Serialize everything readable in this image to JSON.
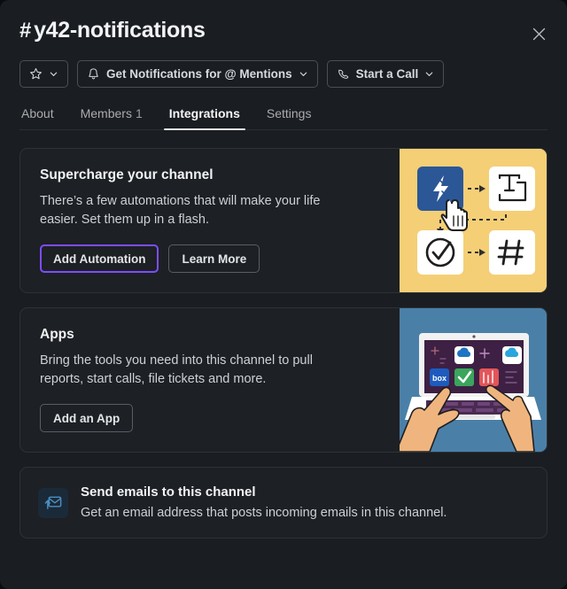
{
  "header": {
    "hash": "#",
    "channel_name": "y42-notifications",
    "close_label": "close-dialog"
  },
  "toolbar": {
    "buttons": [
      {
        "icon": "star-icon",
        "label": "",
        "has_chevron": true,
        "name": "star-channel-button"
      },
      {
        "icon": "bell-icon",
        "label": "Get Notifications for @ Mentions",
        "has_chevron": true,
        "name": "notifications-button"
      },
      {
        "icon": "phone-icon",
        "label": "Start a Call",
        "has_chevron": true,
        "name": "start-call-button"
      }
    ]
  },
  "tabs": [
    {
      "label": "About",
      "count": "",
      "active": false
    },
    {
      "label": "Members",
      "count": "1",
      "active": false
    },
    {
      "label": "Integrations",
      "count": "",
      "active": true
    },
    {
      "label": "Settings",
      "count": "",
      "active": false
    }
  ],
  "cards": [
    {
      "title": "Supercharge your channel",
      "description": "There’s a few automations that will make your life easier. Set them up in a flash.",
      "primary_button": "Add Automation",
      "secondary_button": "Learn More",
      "illustration": "automation-workflow-illustration",
      "illustration_bg": "#f5cf76"
    },
    {
      "title": "Apps",
      "description": "Bring the tools you need into this channel to pull reports, start calls, file tickets and more.",
      "primary_button": "Add an App",
      "illustration": "laptop-hands-apps-illustration",
      "illustration_bg": "#4a80a8"
    }
  ],
  "email_row": {
    "icon": "email-arrow-icon",
    "title": "Send emails to this channel",
    "description": "Get an email address that posts incoming emails in this channel."
  },
  "colors": {
    "modal_bg": "#1a1d21",
    "card_bg": "#1d2024",
    "focus_purple": "#7c4dff",
    "illustration_yellow": "#f5cf76",
    "illustration_blue": "#4a80a8",
    "tile_blue": "#2b5797",
    "laptop_screen": "#3d2043"
  }
}
